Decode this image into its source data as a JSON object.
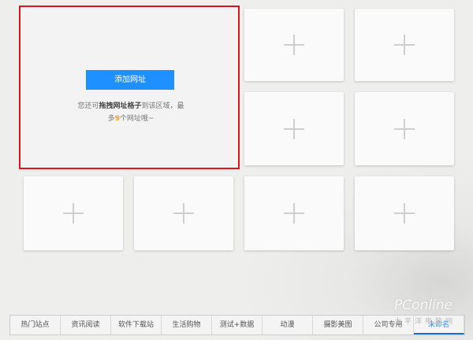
{
  "add_panel": {
    "button_label": "添加网址",
    "hint_prefix": "您还可",
    "hint_bold": "拖拽网址格子",
    "hint_mid": "到该区域，最多",
    "hint_num": "9",
    "hint_suffix": "个网址哦~"
  },
  "tiles_count": 8,
  "tabs": [
    {
      "label": "热门站点"
    },
    {
      "label": "资讯阅读"
    },
    {
      "label": "软件下载站"
    },
    {
      "label": "生活购物"
    },
    {
      "label": "测试+数据"
    },
    {
      "label": "动漫"
    },
    {
      "label": "摄影美图"
    },
    {
      "label": "公司专用"
    },
    {
      "label": "未命名",
      "active": true
    }
  ],
  "watermark": {
    "brand": "PConline",
    "sub": "太平洋电脑网"
  },
  "colors": {
    "accent": "#1e90ff",
    "highlight": "#e0141a"
  }
}
